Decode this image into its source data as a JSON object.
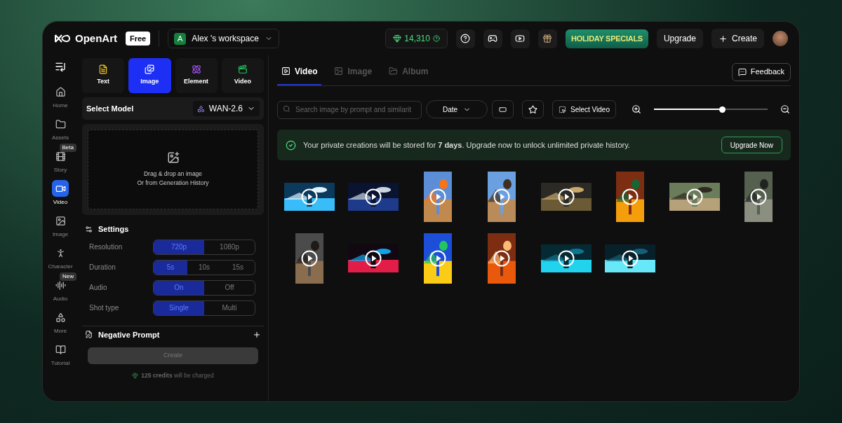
{
  "header": {
    "brand": "OpenArt",
    "plan_badge": "Free",
    "workspace": {
      "initial": "A",
      "name": "Alex 's workspace"
    },
    "credits": "14,310",
    "promo": "HOLIDAY SPECIALS",
    "upgrade": "Upgrade",
    "create": "Create"
  },
  "nav": {
    "items": [
      {
        "label": "Home",
        "selected": false
      },
      {
        "label": "Assets",
        "selected": false
      },
      {
        "label": "Story",
        "selected": false,
        "badge": "Beta"
      },
      {
        "label": "Video",
        "selected": true
      },
      {
        "label": "Image",
        "selected": false
      },
      {
        "label": "Character",
        "selected": false
      },
      {
        "label": "Audio",
        "selected": false,
        "badge": "New"
      },
      {
        "label": "More",
        "selected": false
      },
      {
        "label": "Tutorial",
        "selected": false
      }
    ]
  },
  "modes": [
    {
      "label": "Text",
      "selected": false
    },
    {
      "label": "Image",
      "selected": true
    },
    {
      "label": "Element",
      "selected": false
    },
    {
      "label": "Video",
      "selected": false
    }
  ],
  "model": {
    "label": "Select Model",
    "value": "WAN-2.6"
  },
  "dropzone": {
    "line1": "Drag & drop an image",
    "line2": "Or from Generation History"
  },
  "settings": {
    "title": "Settings",
    "rows": [
      {
        "label": "Resolution",
        "options": [
          {
            "label": "720p",
            "selected": true
          },
          {
            "label": "1080p",
            "selected": false
          }
        ]
      },
      {
        "label": "Duration",
        "options": [
          {
            "label": "5s",
            "selected": true
          },
          {
            "label": "10s",
            "selected": false
          },
          {
            "label": "15s",
            "selected": false
          }
        ]
      },
      {
        "label": "Audio",
        "options": [
          {
            "label": "On",
            "selected": true
          },
          {
            "label": "Off",
            "selected": false
          }
        ]
      },
      {
        "label": "Shot type",
        "options": [
          {
            "label": "Single",
            "selected": true
          },
          {
            "label": "Multi",
            "selected": false
          }
        ]
      }
    ]
  },
  "negative_prompt": {
    "title": "Negative Prompt",
    "expanded": false
  },
  "create_button": {
    "label": "Create",
    "disabled": true
  },
  "cost_note": "**125 credits** will be charged",
  "library": {
    "tabs": [
      {
        "label": "Video",
        "selected": true
      },
      {
        "label": "Image",
        "selected": false
      },
      {
        "label": "Album",
        "selected": false
      }
    ],
    "feedback": "Feedback",
    "search": {
      "placeholder": "Search image by prompt and similarit"
    },
    "sort": "Date",
    "select_button": "Select Video",
    "zoom": {
      "level": 0.6
    },
    "banner": {
      "text": "Your private creations will be stored for **7 days**. Upgrade now to unlock unlimited private history.",
      "action": "Upgrade Now"
    },
    "videos": [
      {
        "kind": "landscape"
      },
      {
        "kind": "landscape"
      },
      {
        "kind": "portrait"
      },
      {
        "kind": "portrait"
      },
      {
        "kind": "landscape"
      },
      {
        "kind": "portrait"
      },
      {
        "kind": "landscape"
      },
      {
        "kind": "portrait"
      },
      {
        "kind": "portrait"
      },
      {
        "kind": "landscape"
      },
      {
        "kind": "portrait"
      },
      {
        "kind": "portrait"
      },
      {
        "kind": "landscape"
      },
      {
        "kind": "landscape"
      }
    ]
  }
}
